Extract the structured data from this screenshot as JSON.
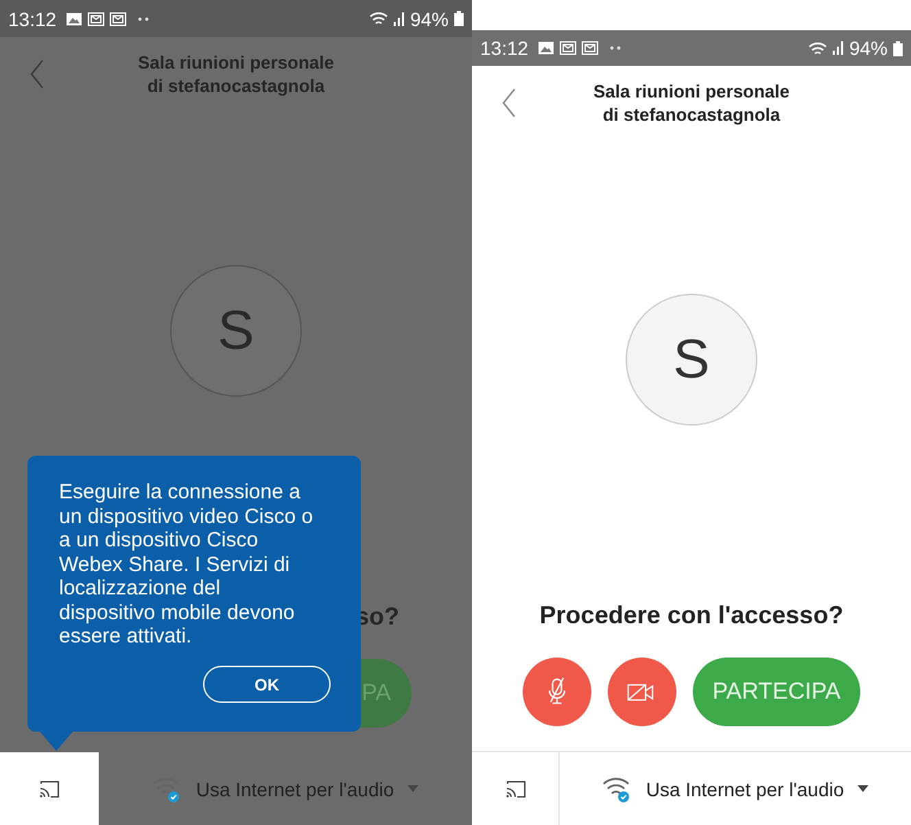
{
  "screens": [
    {
      "dimmed": true,
      "status_bar": {
        "time": "13:12",
        "battery": "94%"
      },
      "header": {
        "title_lines": [
          "Sala riunioni personale",
          "di stefanocastagnola"
        ]
      },
      "avatar": {
        "initial": "S"
      },
      "prompt": "so?",
      "buttons": [
        {
          "kind": "join",
          "label": "PA"
        }
      ],
      "popup": {
        "message": "Eseguire la connessione a un dispositivo video Cisco o a un dispositivo Cisco Webex Share. I Servizi di localizzazione del dispositivo mobile devono essere attivati.",
        "button": "OK"
      },
      "bottom_bar": {
        "cast_highlighted": true,
        "audio_label": "Usa Internet per l'audio"
      }
    },
    {
      "dimmed": false,
      "status_bar": {
        "time": "13:12",
        "battery": "94%"
      },
      "header": {
        "title_lines": [
          "Sala riunioni personale",
          "di stefanocastagnola"
        ]
      },
      "avatar": {
        "initial": "S"
      },
      "prompt": "Procedere con l'accesso?",
      "buttons": [
        {
          "kind": "mic",
          "muted": true
        },
        {
          "kind": "video",
          "muted": true
        },
        {
          "kind": "join",
          "label": "PARTECIPA"
        }
      ],
      "bottom_bar": {
        "cast_highlighted": false,
        "audio_label": "Usa Internet per l'audio"
      }
    }
  ]
}
